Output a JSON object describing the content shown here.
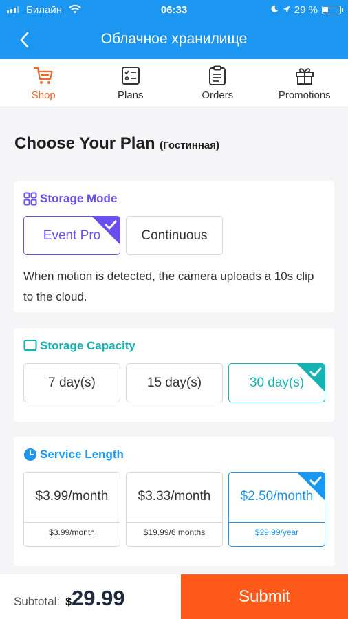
{
  "status_bar": {
    "carrier": "Билайн",
    "time": "06:33",
    "battery": "29 %"
  },
  "header": {
    "title": "Облачное хранилище"
  },
  "tabs": [
    {
      "label": "Shop",
      "icon": "cart-icon",
      "active": true
    },
    {
      "label": "Plans",
      "icon": "checklist-icon"
    },
    {
      "label": "Orders",
      "icon": "clipboard-icon"
    },
    {
      "label": "Promotions",
      "icon": "gift-icon"
    }
  ],
  "heading": {
    "title": "Choose Your Plan",
    "subtitle": "(Гостинная)"
  },
  "storage_mode": {
    "title": "Storage Mode",
    "options": [
      "Event Pro",
      "Continuous"
    ],
    "selected": "Event Pro",
    "description": "When motion is detected, the camera uploads a 10s clip to the cloud."
  },
  "storage_capacity": {
    "title": "Storage Capacity",
    "options": [
      "7 day(s)",
      "15 day(s)",
      "30 day(s)"
    ],
    "selected": "30 day(s)"
  },
  "service_length": {
    "title": "Service Length",
    "options": [
      {
        "price": "$3.99/month",
        "detail": "$3.99/month"
      },
      {
        "price": "$3.33/month",
        "detail": "$19.99/6 months"
      },
      {
        "price": "$2.50/month",
        "detail": "$29.99/year"
      }
    ],
    "selected": "$2.50/month"
  },
  "footer": {
    "subtotal_label": "Subtotal:",
    "currency": "$",
    "amount": "29.99",
    "submit_label": "Submit"
  },
  "colors": {
    "header_blue": "#1b96f1",
    "active_orange": "#f26a2a",
    "mode_purple": "#6b4ef1",
    "capacity_teal": "#17b3b2",
    "submit_orange": "#ff5a1a"
  }
}
